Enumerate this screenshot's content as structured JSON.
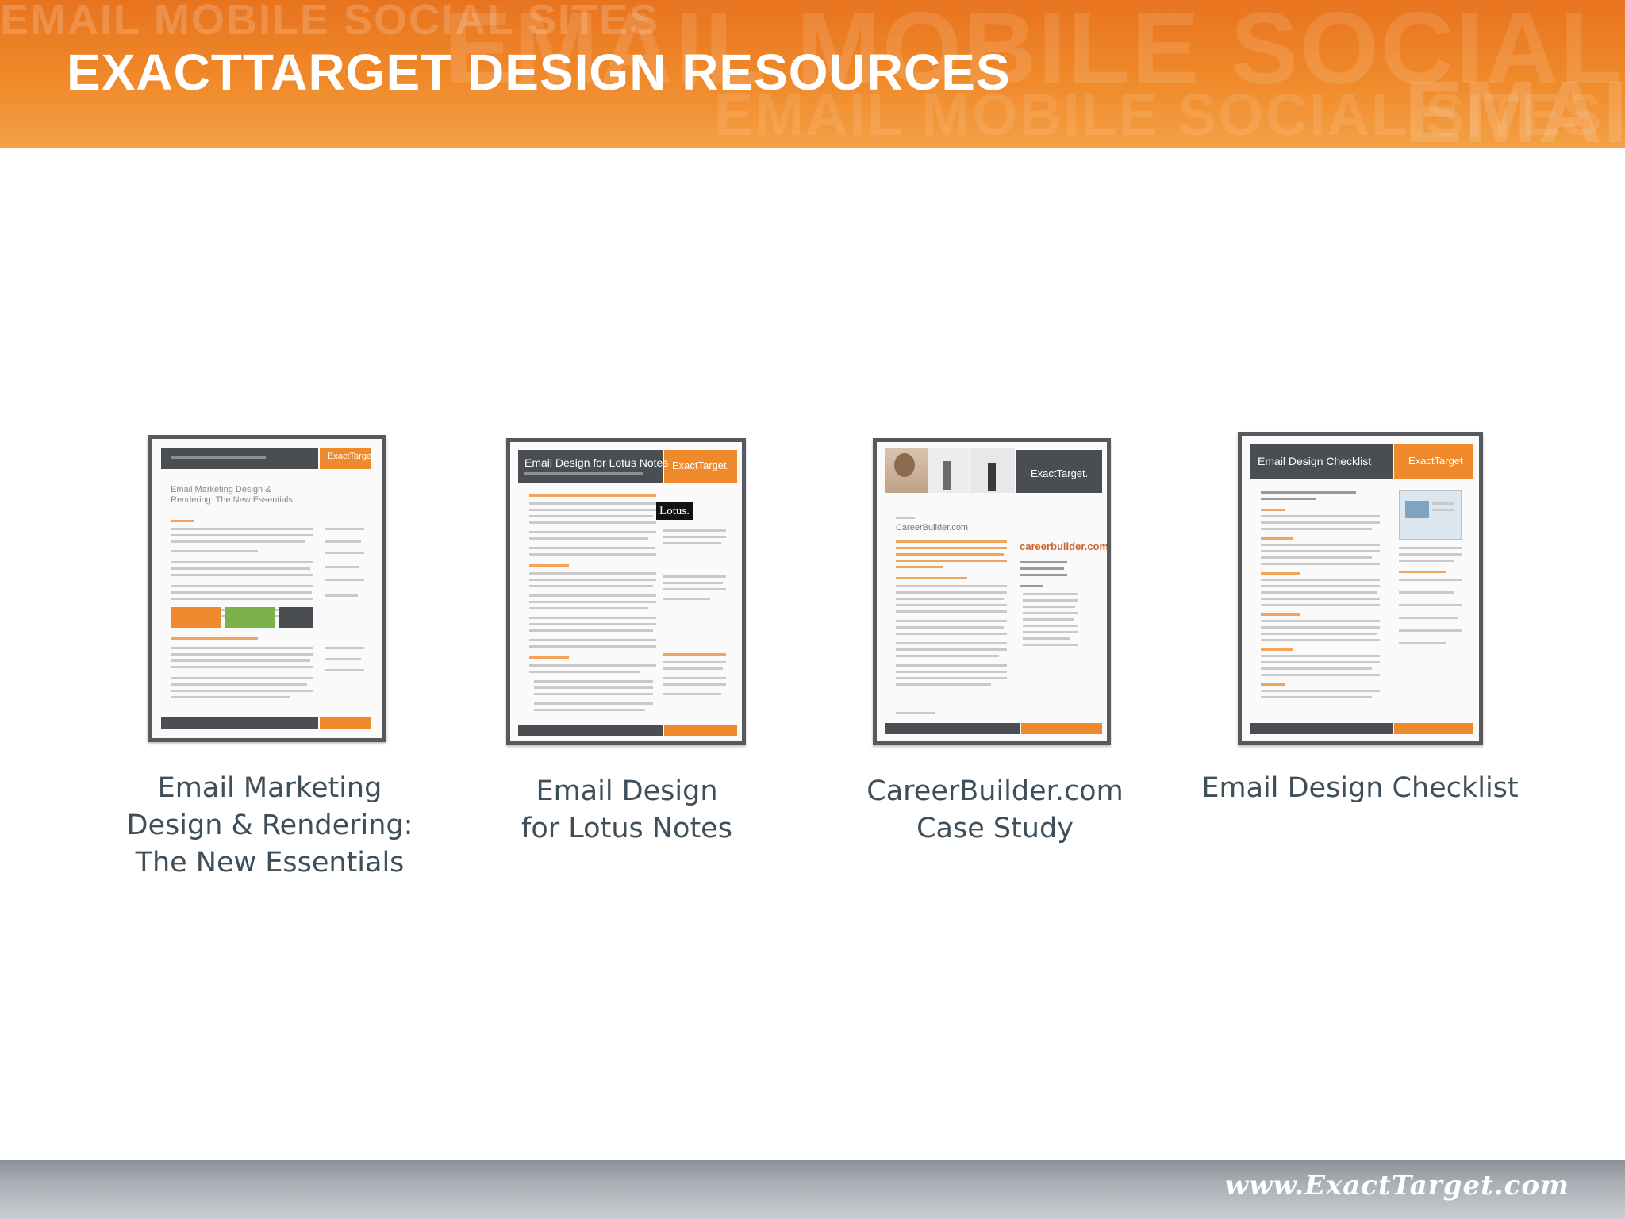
{
  "slide": {
    "title": "EXACTTARGET DESIGN RESOURCES",
    "watermark": "EMAIL MOBILE SOCIAL SITES"
  },
  "resources": [
    {
      "caption": [
        "Email Marketing",
        "Design & Rendering:",
        "The New Essentials"
      ],
      "doc_brand": "ExactTarget",
      "doc_heading": "Email Marketing Design & Rendering: The New Essentials"
    },
    {
      "caption": [
        "Email Design",
        "for Lotus Notes"
      ],
      "doc_header": "Email Design for Lotus Notes",
      "doc_brand": "ExactTarget.",
      "doc_logo": "Lotus."
    },
    {
      "caption": [
        "CareerBuilder.com",
        "Case Study"
      ],
      "doc_brand": "ExactTarget.",
      "doc_subtitle": "CareerBuilder.com",
      "doc_logo": "careerbuilder.com"
    },
    {
      "caption": [
        "Email Design Checklist"
      ],
      "doc_header": "Email Design Checklist",
      "doc_brand": "ExactTarget"
    }
  ],
  "footer": {
    "url": "www.ExactTarget.com"
  },
  "colors": {
    "accent": "#ee8a2c",
    "dark": "#4a4d52",
    "caption": "#3f4f5a"
  }
}
